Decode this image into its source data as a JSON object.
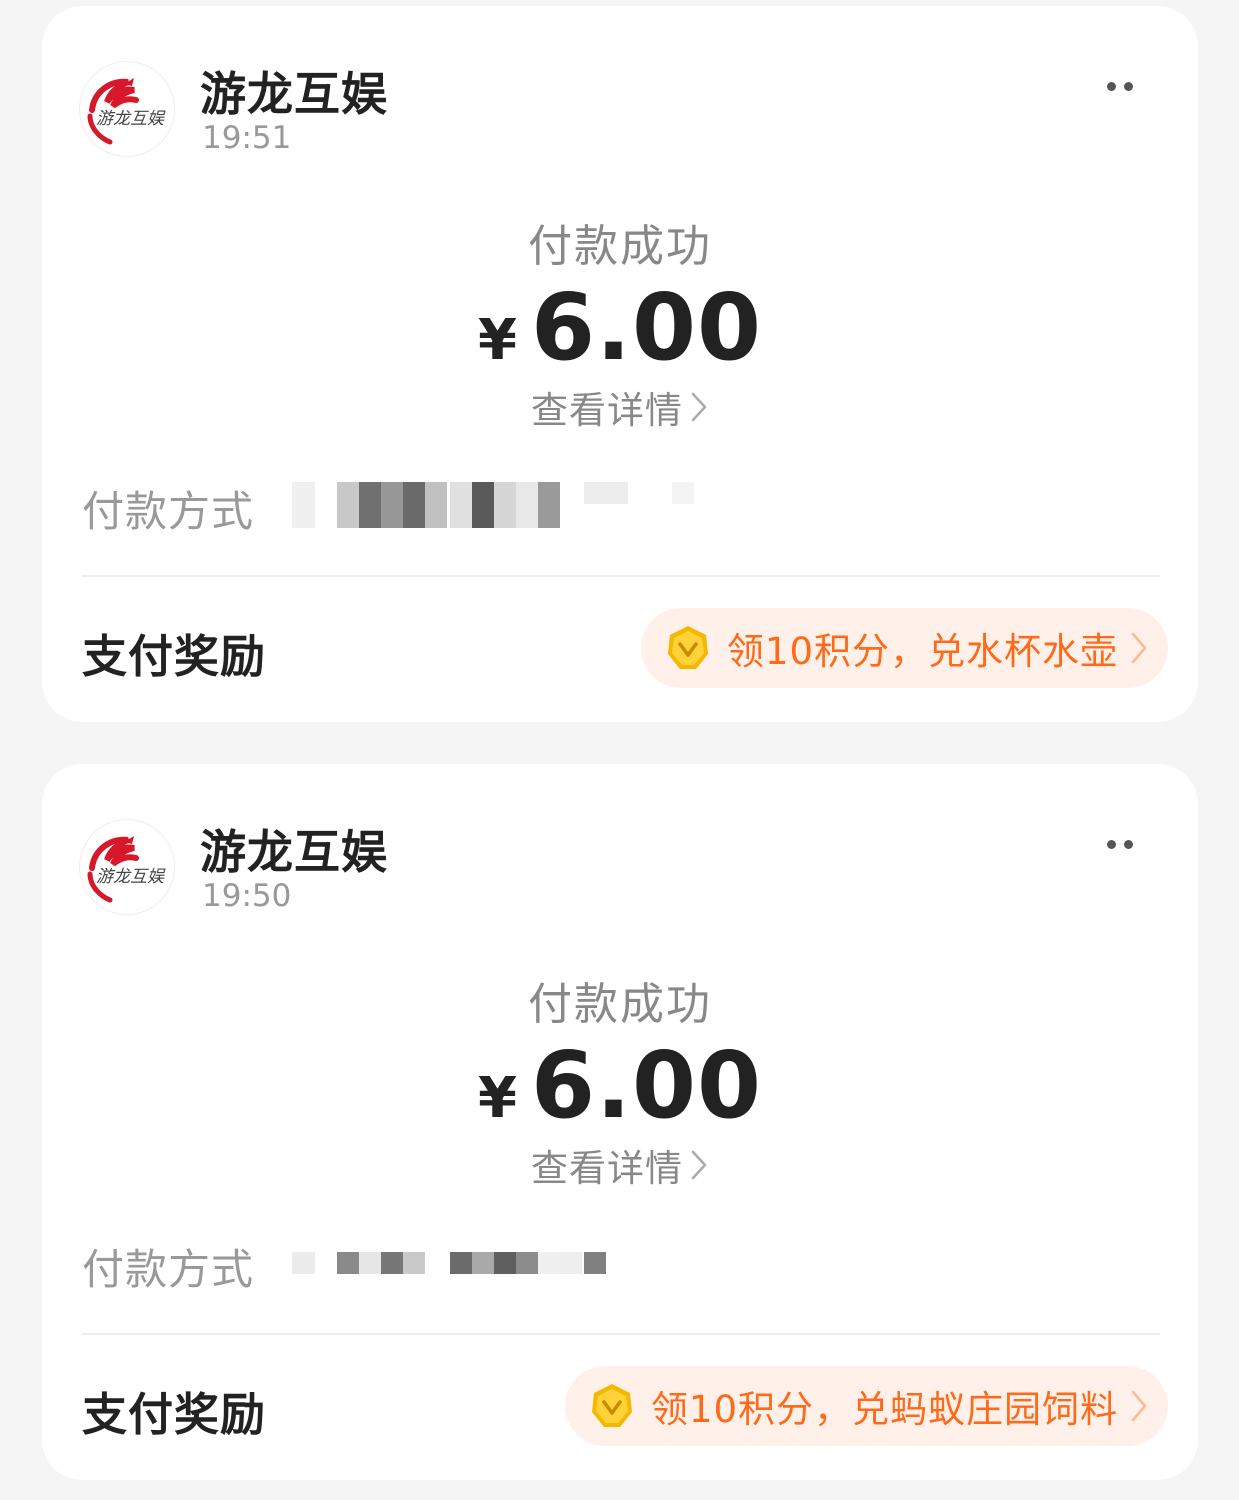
{
  "colors": {
    "page_background": "#f5f5f5",
    "card_background": "#ffffff",
    "reward_accent": "#ff6a1a",
    "reward_pill_background": "#fff1e9",
    "logo_red": "#d7172a",
    "coin_gold": "#f5b800"
  },
  "payments": [
    {
      "merchant": {
        "name": "游龙互娱",
        "logo_icon": "dragon-logo-icon",
        "logo_text": "游龙互娱"
      },
      "time": "19:51",
      "status": "付款成功",
      "currency_symbol": "¥",
      "amount": "6.00",
      "details_link": "查看详情",
      "payment_method_label": "付款方式",
      "payment_method_value": "(blurred)",
      "reward_label": "支付奖励",
      "reward_text": "领10积分，兑水杯水壶",
      "reward_icon": "gold-coin-icon"
    },
    {
      "merchant": {
        "name": "游龙互娱",
        "logo_icon": "dragon-logo-icon",
        "logo_text": "游龙互娱"
      },
      "time": "19:50",
      "status": "付款成功",
      "currency_symbol": "¥",
      "amount": "6.00",
      "details_link": "查看详情",
      "payment_method_label": "付款方式",
      "payment_method_value": "(blurred)",
      "reward_label": "支付奖励",
      "reward_text": "领10积分，兑蚂蚁庄园饲料",
      "reward_icon": "gold-coin-icon"
    }
  ]
}
